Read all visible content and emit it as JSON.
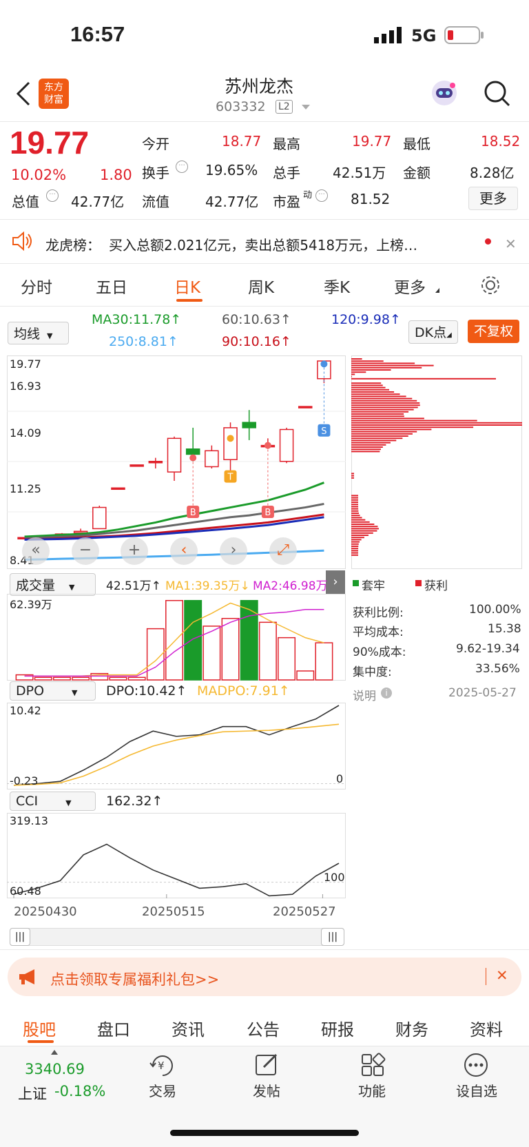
{
  "status": {
    "time": "16:57",
    "network": "5G"
  },
  "header": {
    "name": "苏州龙杰",
    "code": "603332",
    "level": "L2",
    "logo": "东方\n财富"
  },
  "quote": {
    "price": "19.77",
    "pct": "10.02%",
    "chg": "1.80",
    "rows": [
      [
        {
          "k": "今开",
          "v": "18.77",
          "c": "red"
        },
        {
          "k": "最高",
          "v": "19.77",
          "c": "red"
        },
        {
          "k": "最低",
          "v": "18.52",
          "c": "red"
        }
      ],
      [
        {
          "k": "换手",
          "v": "19.65%",
          "c": "dark"
        },
        {
          "k": "总手",
          "v": "42.51万",
          "c": "dark"
        },
        {
          "k": "金额",
          "v": "8.28亿",
          "c": "dark"
        }
      ],
      [
        {
          "k": "总值",
          "v": "42.77亿",
          "c": "dark"
        },
        {
          "k": "流值",
          "v": "42.77亿",
          "c": "dark"
        },
        {
          "k": "市盈",
          "v": "81.52",
          "c": "dark"
        }
      ]
    ],
    "more": "更多"
  },
  "notice": {
    "label": "龙虎榜：",
    "text": "买入总额2.021亿元，卖出总额5418万元，上榜…"
  },
  "tabs": [
    "分时",
    "五日",
    "日K",
    "周K",
    "季K",
    "更多"
  ],
  "ma": {
    "select": "均线",
    "ma30": "MA30:11.78↑",
    "m60": "60:10.63↑",
    "m120": "120:9.98↑",
    "m250": "250:8.81↑",
    "m90": "90:10.16↑",
    "dk": "DK点",
    "fq": "不复权"
  },
  "kline": {
    "y_labels": [
      "19.77",
      "16.93",
      "14.09",
      "11.25",
      "8.41"
    ],
    "markers": {
      "b": "B",
      "t": "T",
      "s": "S"
    }
  },
  "volume": {
    "select": "成交量",
    "val": "42.51万↑",
    "ma1": "MA1:39.35万↓",
    "ma2": "MA2:46.98万",
    "top": "62.39万"
  },
  "dpo": {
    "select": "DPO",
    "val": "DPO:10.42↑",
    "mad": "MADPO:7.91↑",
    "top": "10.42",
    "bottom": "-0.23",
    "zero": "0"
  },
  "cci": {
    "select": "CCI",
    "val": "162.32↑",
    "top": "319.13",
    "bottom": "60.48",
    "ref": "100"
  },
  "dates": [
    "20250430",
    "20250515",
    "20250527"
  ],
  "dist": {
    "legend_trap": "套牢",
    "legend_profit": "获利",
    "rows": [
      {
        "k": "获利比例:",
        "v": "100.00%"
      },
      {
        "k": "平均成本:",
        "v": "15.38"
      },
      {
        "k": "90%成本:",
        "v": "9.62-19.34"
      },
      {
        "k": "集中度:",
        "v": "33.56%"
      }
    ],
    "note": "说明",
    "date": "2025-05-27"
  },
  "promo": "点击领取专属福利礼包>>",
  "bottom_tabs": [
    "股吧",
    "盘口",
    "资讯",
    "公告",
    "研报",
    "财务",
    "资料"
  ],
  "footer": {
    "index_val": "3340.69",
    "index_name": "上证",
    "index_pct": "-0.18%",
    "items": [
      "交易",
      "发帖",
      "功能",
      "设自选"
    ]
  },
  "colors": {
    "up": "#e0202a",
    "down": "#1a9b2a",
    "accent": "#f05a14"
  },
  "chart_data": [
    {
      "type": "candlestick",
      "title": "",
      "ylim": [
        8.41,
        19.77
      ],
      "candles": [
        [
          9.8,
          9.8,
          9.8,
          9.8
        ],
        [
          9.85,
          9.9,
          9.85,
          9.9
        ],
        [
          10.0,
          10.05,
          9.95,
          10.0
        ],
        [
          10.1,
          10.3,
          10.0,
          10.15
        ],
        [
          10.3,
          11.6,
          10.3,
          11.5
        ],
        [
          12.6,
          12.6,
          12.6,
          12.6
        ],
        [
          13.9,
          13.9,
          13.9,
          13.9
        ],
        [
          14.1,
          14.3,
          13.7,
          14.1
        ],
        [
          13.5,
          15.5,
          13.0,
          15.4
        ],
        [
          14.8,
          16.0,
          14.1,
          14.5
        ],
        [
          13.8,
          15.0,
          13.7,
          14.7
        ],
        [
          14.2,
          16.3,
          13.5,
          16.0
        ],
        [
          16.3,
          17.0,
          15.3,
          16.0
        ],
        [
          15.0,
          15.4,
          14.8,
          15.0
        ],
        [
          14.1,
          16.0,
          14.0,
          15.9
        ],
        [
          17.2,
          17.2,
          17.2,
          17.2
        ],
        [
          18.77,
          19.77,
          18.52,
          19.77
        ]
      ]
    },
    {
      "type": "bar",
      "title": "成交量",
      "values": [
        4,
        2,
        2,
        2,
        5,
        2,
        2,
        40,
        62,
        62,
        42,
        48,
        62,
        45,
        33,
        7,
        29
      ]
    },
    {
      "type": "line",
      "title": "DPO",
      "series": [
        {
          "name": "DPO",
          "values": [
            -0.23,
            0.0,
            0.3,
            1.8,
            3.5,
            5.6,
            7.0,
            6.3,
            6.5,
            7.6,
            7.6,
            6.5,
            7.6,
            8.6,
            10.42
          ]
        },
        {
          "name": "MADPO",
          "values": [
            -0.23,
            -0.1,
            0.1,
            1.0,
            2.3,
            3.8,
            5.0,
            5.8,
            6.4,
            6.9,
            7.0,
            7.1,
            7.3,
            7.6,
            7.91
          ]
        }
      ]
    },
    {
      "type": "line",
      "title": "CCI",
      "series": [
        {
          "name": "CCI",
          "values": [
            60.48,
            80,
            105,
            190,
            225,
            180,
            140,
            110,
            80,
            85,
            95,
            55,
            60,
            120,
            162.32
          ]
        }
      ]
    }
  ]
}
